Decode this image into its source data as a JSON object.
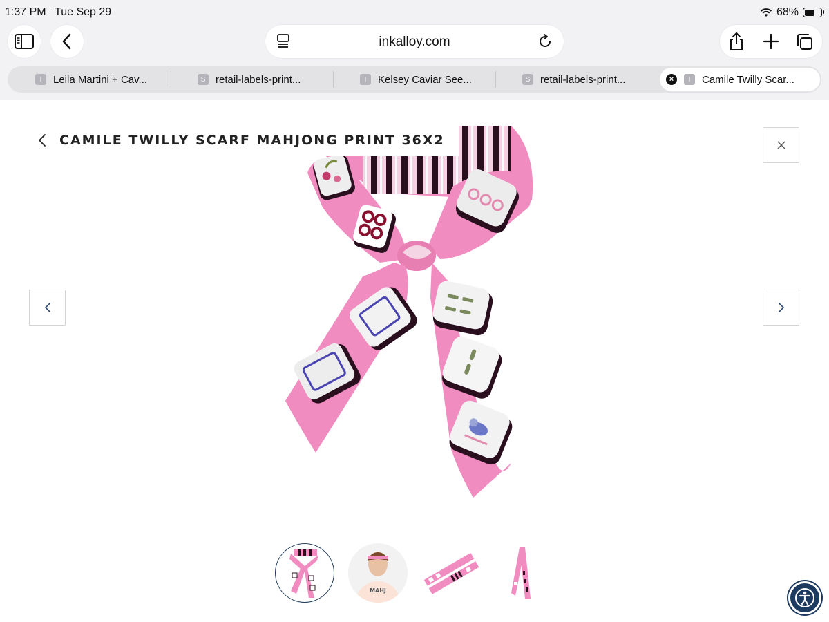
{
  "status_bar": {
    "time": "1:37 PM",
    "date": "Tue Sep 29",
    "battery": "68%",
    "battery_level": 0.68,
    "icons": [
      "wifi-icon",
      "battery-icon"
    ]
  },
  "browser": {
    "url": "inkalloy.com",
    "left_icons": [
      "sidebar-icon",
      "back-icon"
    ],
    "address_icons": [
      "page-menu-icon",
      "reload-icon"
    ],
    "right_icons": [
      "share-icon",
      "new-tab-icon",
      "tabs-overview-icon"
    ],
    "tabs": [
      {
        "favicon": "I",
        "label": "Leila Martini + Cav..."
      },
      {
        "favicon": "S",
        "label": "retail-labels-print..."
      },
      {
        "favicon": "I",
        "label": "Kelsey Caviar See..."
      },
      {
        "favicon": "S",
        "label": "retail-labels-print..."
      },
      {
        "favicon": "I",
        "label": "Camile Twilly Scar...",
        "active": true,
        "close": "×"
      }
    ]
  },
  "product": {
    "title": "CAMILE TWILLY SCARF MAHJONG PRINT 36X2",
    "icons": [
      "chevron-left-icon",
      "close-icon",
      "arrow-left-icon",
      "arrow-right-icon"
    ],
    "thumbnails": [
      {
        "name": "scarf-tied",
        "selected": true
      },
      {
        "name": "model-headband",
        "shirt_text": "MAHJ"
      },
      {
        "name": "scarf-flat"
      },
      {
        "name": "scarf-hanging"
      }
    ]
  },
  "accessibility": {
    "icon": "accessibility-icon"
  },
  "colors": {
    "chrome_bg": "#f2f2f4",
    "tab_bar_bg": "#e3e3e6",
    "scarf_pink": "#f08cc0",
    "stripe_dark": "#2a0f1e",
    "accent_navy": "#1d3a60"
  }
}
